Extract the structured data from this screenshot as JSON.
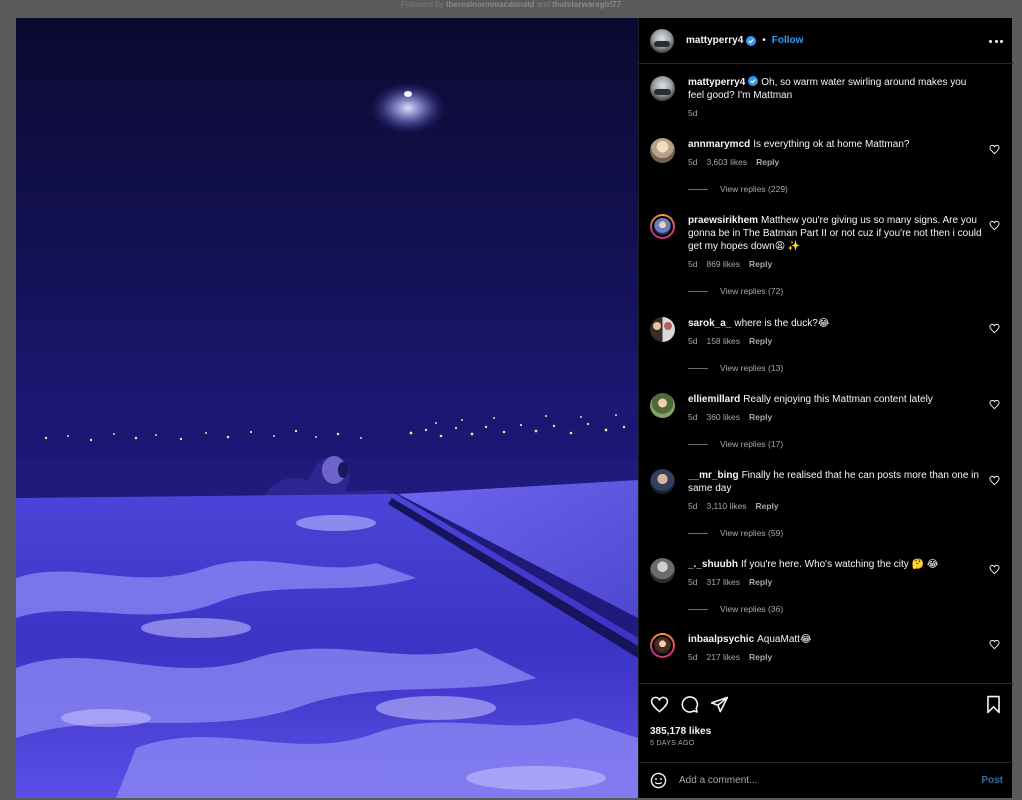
{
  "followed_by": {
    "prefix": "Followed by",
    "user1": "therealnormmacdonald",
    "joiner": "and",
    "user2": "thatstarwarsgirl77"
  },
  "header": {
    "username": "mattyperry4",
    "separator": "•",
    "follow_label": "Follow"
  },
  "caption": {
    "username": "mattyperry4",
    "text": "Oh, so warm water swirling around makes you feel good? I'm Mattman",
    "time": "5d"
  },
  "comments": [
    {
      "username": "annmarymcd",
      "text": "Is everything ok at home Mattman?",
      "time": "5d",
      "likes": "3,603 likes",
      "reply_label": "Reply",
      "view_replies": "View replies (229)"
    },
    {
      "username": "praewsirikhem",
      "text": "Matthew you're giving us so many signs. Are you gonna be in The Batman Part II or not cuz if you're not then i could get my hopes down😩 ✨",
      "time": "5d",
      "likes": "869 likes",
      "reply_label": "Reply",
      "view_replies": "View replies (72)"
    },
    {
      "username": "sarok_a_",
      "text": "where is the duck?😂",
      "time": "5d",
      "likes": "158 likes",
      "reply_label": "Reply",
      "view_replies": "View replies (13)"
    },
    {
      "username": "elliemillard",
      "text": "Really enjoying this Mattman content lately",
      "time": "5d",
      "likes": "360 likes",
      "reply_label": "Reply",
      "view_replies": "View replies (17)"
    },
    {
      "username": "__mr_bing",
      "text": "Finally he realised that he can posts more than one in same day",
      "time": "5d",
      "likes": "3,110 likes",
      "reply_label": "Reply",
      "view_replies": "View replies (59)"
    },
    {
      "username": "_._shuubh",
      "text": "If you're here. Who's watching the city 🤔 😂",
      "time": "5d",
      "likes": "317 likes",
      "reply_label": "Reply",
      "view_replies": "View replies (36)"
    },
    {
      "username": "inbaalpsychic",
      "text": "AquaMatt😂",
      "time": "5d",
      "likes": "217 likes",
      "reply_label": "Reply"
    }
  ],
  "actions": {
    "likes": "385,178 likes",
    "date": "5 DAYS AGO"
  },
  "add_comment": {
    "placeholder": "Add a comment...",
    "post_label": "Post"
  },
  "colors": {
    "link": "#2d9bf0",
    "verified": "#3897f0",
    "pool": "#3f3ad0"
  },
  "icons": [
    "verified-icon",
    "more-icon",
    "heart-icon",
    "comment-icon",
    "share-icon",
    "bookmark-icon",
    "emoji-icon"
  ]
}
